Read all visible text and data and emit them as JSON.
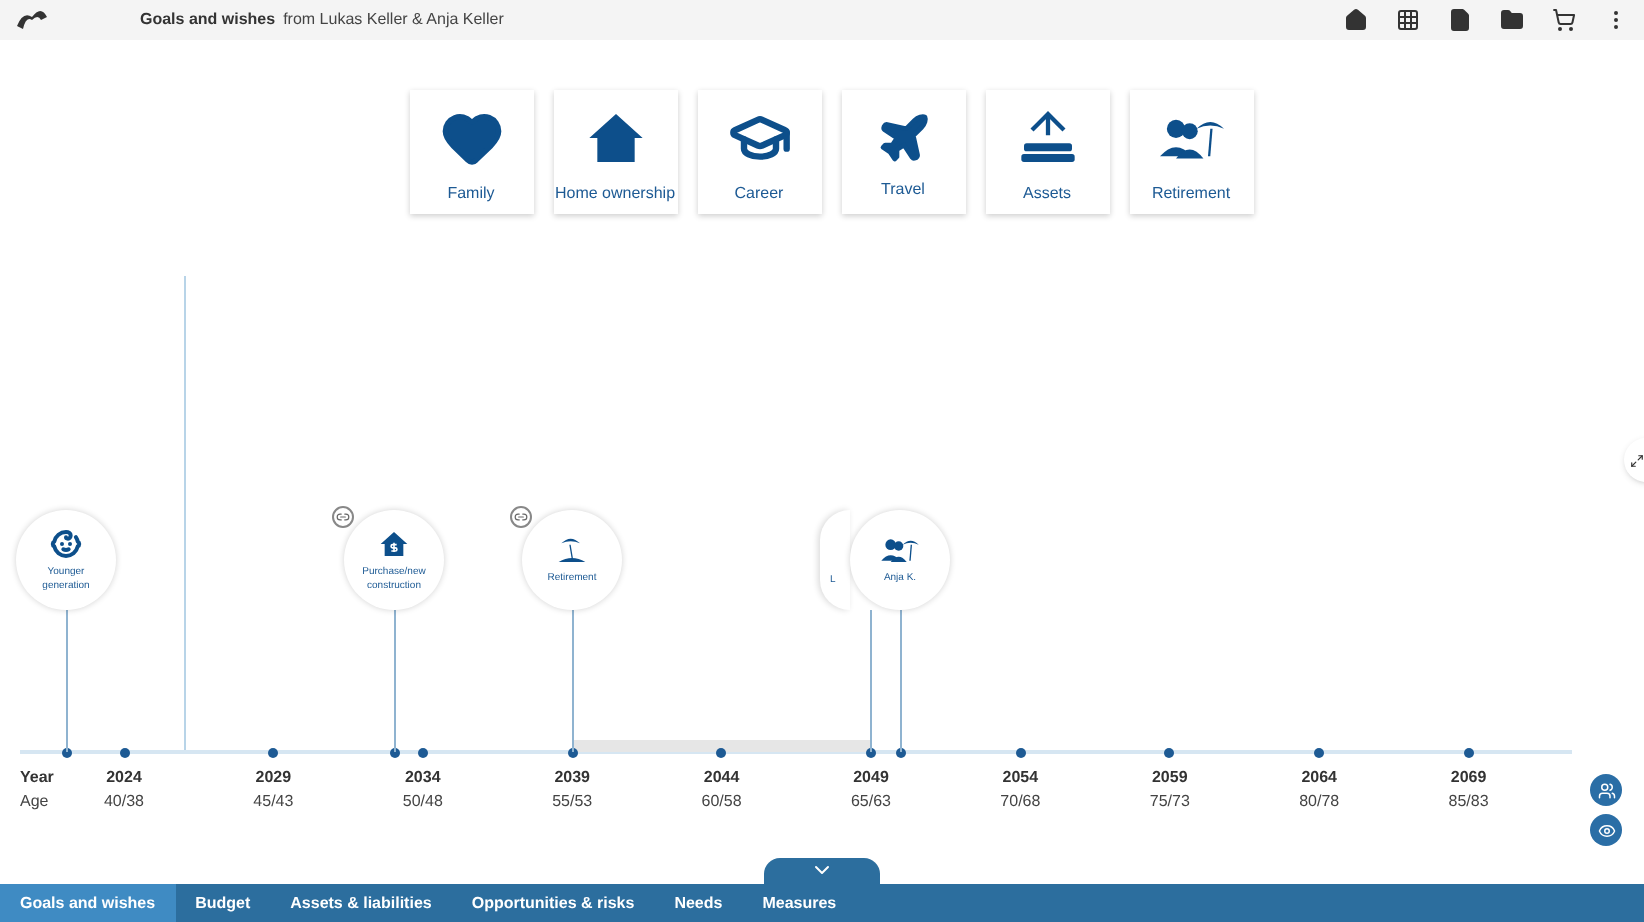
{
  "header": {
    "title": "Goals and wishes",
    "subtitle": "from Lukas Keller & Anja Keller"
  },
  "goal_categories": [
    {
      "label": "Family",
      "kind": "heart"
    },
    {
      "label": "Home ownership",
      "kind": "house"
    },
    {
      "label": "Career",
      "kind": "cap"
    },
    {
      "label": "Travel",
      "kind": "plane"
    },
    {
      "label": "Assets",
      "kind": "assets"
    },
    {
      "label": "Retirement",
      "kind": "retire"
    }
  ],
  "timeline_goals": [
    {
      "label": "Younger generation",
      "kind": "baby",
      "linked": false
    },
    {
      "label": "Purchase/new construction",
      "kind": "house",
      "linked": true
    },
    {
      "label": "Retirement",
      "kind": "beach",
      "linked": true
    },
    {
      "label": "L",
      "kind": "none",
      "linked": false
    },
    {
      "label": "Anja K.",
      "kind": "retire",
      "linked": false
    }
  ],
  "axis": {
    "year_label": "Year",
    "age_label": "Age",
    "ticks": [
      {
        "year": "2024",
        "age": "40/38"
      },
      {
        "year": "2029",
        "age": "45/43"
      },
      {
        "year": "2034",
        "age": "50/48"
      },
      {
        "year": "2039",
        "age": "55/53"
      },
      {
        "year": "2044",
        "age": "60/58"
      },
      {
        "year": "2049",
        "age": "65/63"
      },
      {
        "year": "2054",
        "age": "70/68"
      },
      {
        "year": "2059",
        "age": "75/73"
      },
      {
        "year": "2064",
        "age": "80/78"
      },
      {
        "year": "2069",
        "age": "85/83"
      }
    ]
  },
  "tabs": [
    {
      "label": "Goals and wishes",
      "selected": true
    },
    {
      "label": "Budget",
      "selected": false
    },
    {
      "label": "Assets & liabilities",
      "selected": false
    },
    {
      "label": "Opportunities & risks",
      "selected": false
    },
    {
      "label": "Needs",
      "selected": false
    },
    {
      "label": "Measures",
      "selected": false
    }
  ]
}
